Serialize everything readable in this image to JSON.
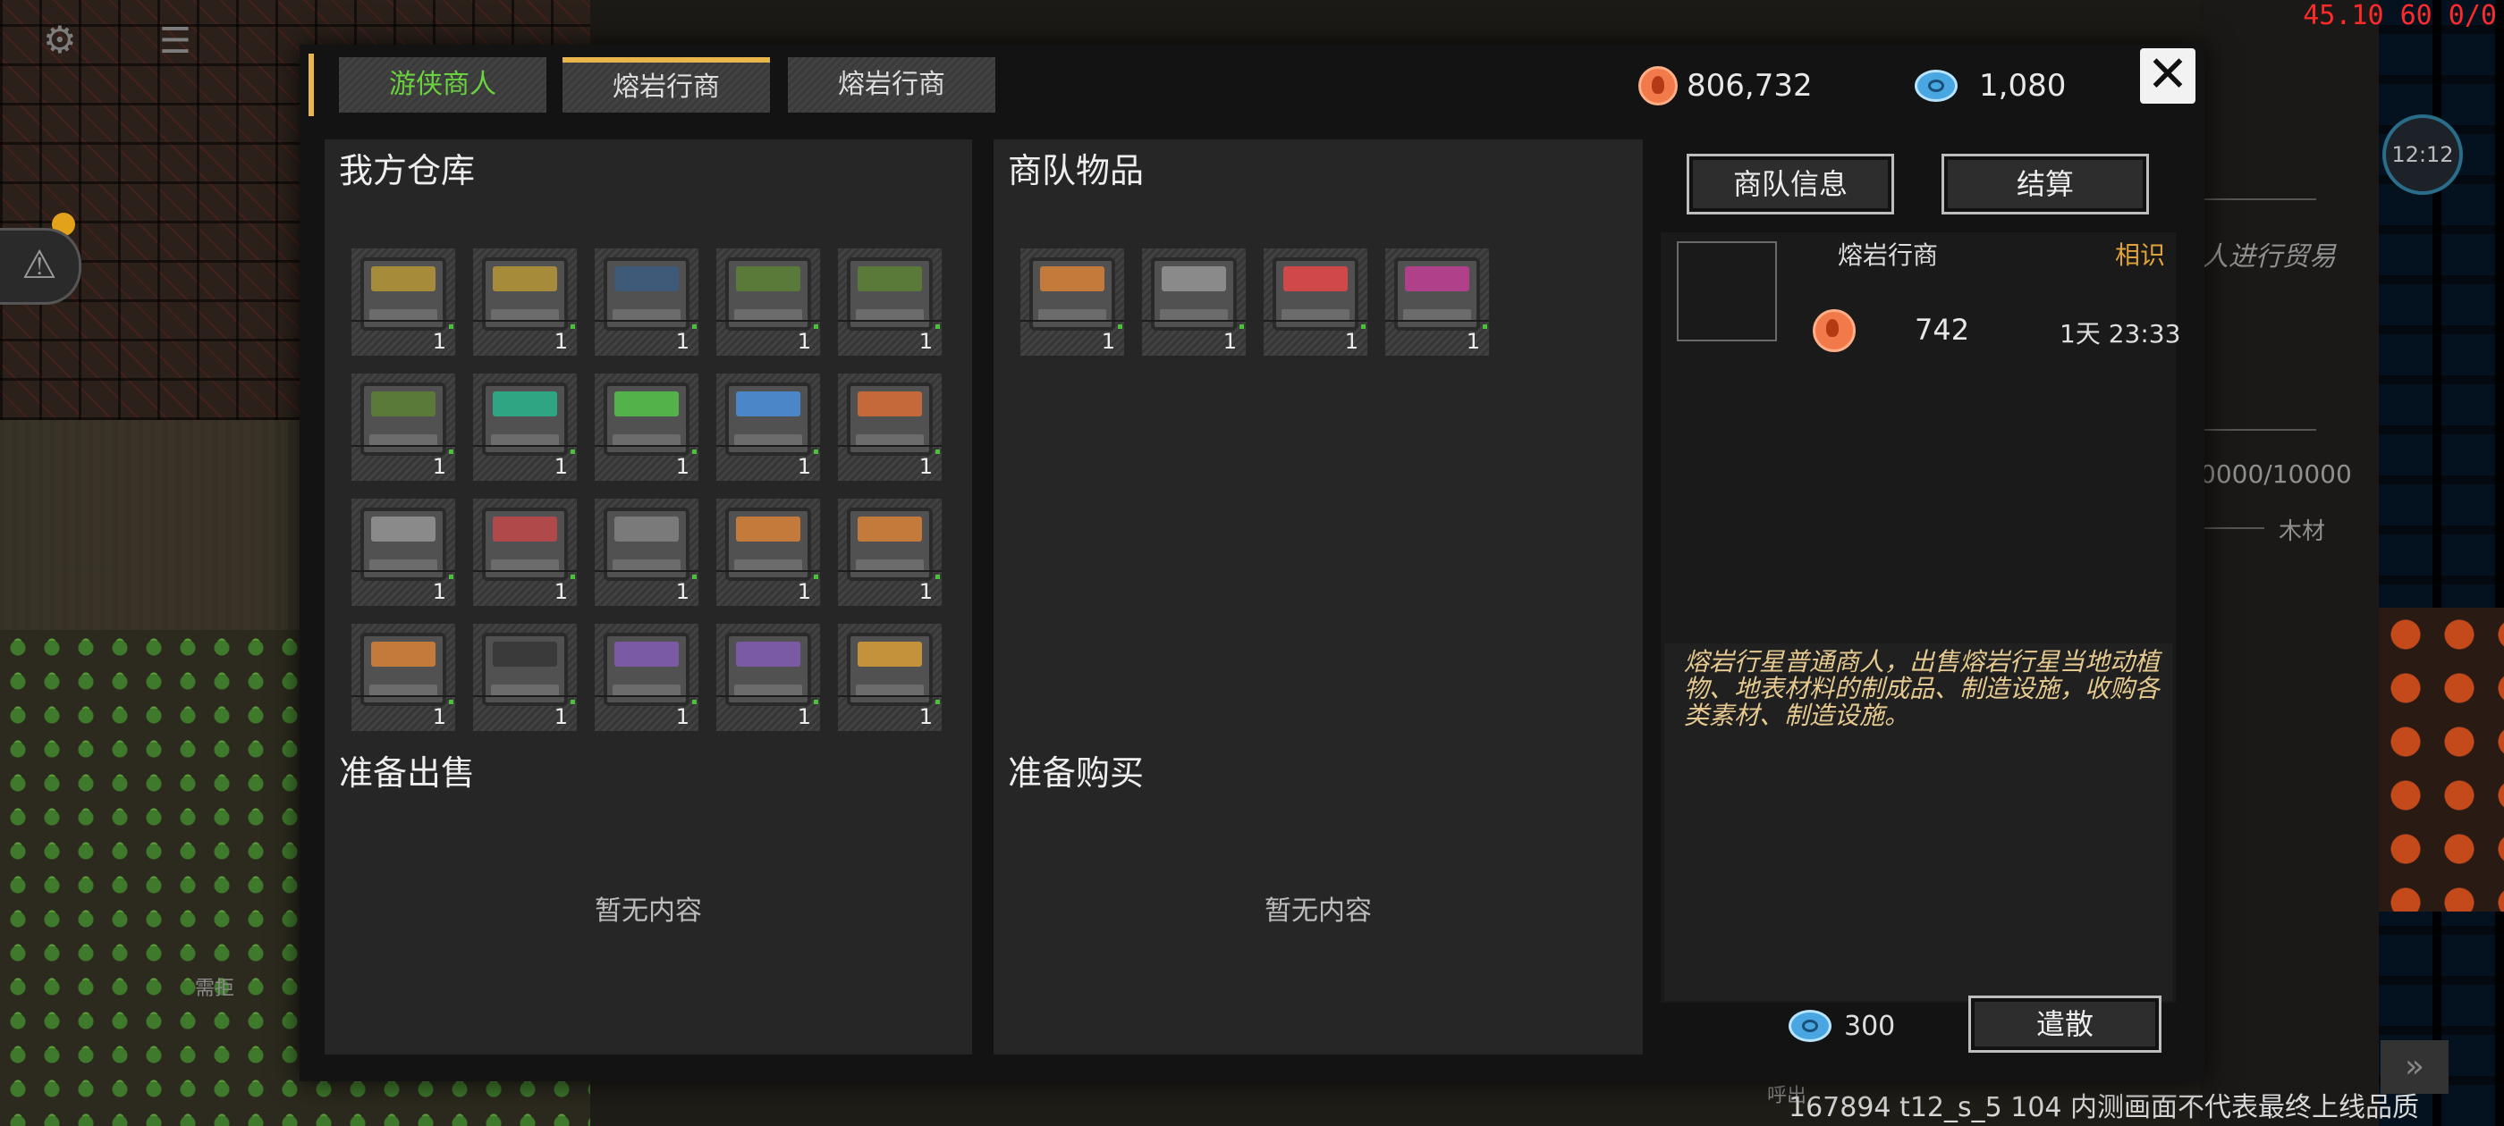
{
  "overlay": {
    "fps": "45.10 60 0/0",
    "build_info": "167894 t12_s_5 104 内测画面不代表最终上线品质",
    "map_label": "需拒",
    "map_label_2": "呼出",
    "side_text_trade": "人进行贸易",
    "side_text_capacity": "0000/10000",
    "side_text_wood": "木材",
    "clock": "12:12"
  },
  "hud": {
    "gear": "⚙",
    "chat": "☰",
    "alert": "⚠",
    "fast_forward": "»"
  },
  "tabs": [
    {
      "label": "游侠商人"
    },
    {
      "label": "熔岩行商"
    },
    {
      "label": "熔岩行商"
    }
  ],
  "currency": {
    "coins": "806,732",
    "gems": "1,080"
  },
  "close_label": "✕",
  "my_storage": {
    "title": "我方仓库",
    "items": [
      {
        "qty": "1",
        "color": "#a58b3a"
      },
      {
        "qty": "1",
        "color": "#a58b3a"
      },
      {
        "qty": "1",
        "color": "#3e5a78"
      },
      {
        "qty": "1",
        "color": "#5a7a3a"
      },
      {
        "qty": "1",
        "color": "#5a7a3a"
      },
      {
        "qty": "1",
        "color": "#5a7a3a"
      },
      {
        "qty": "1",
        "color": "#2fa584"
      },
      {
        "qty": "1",
        "color": "#53b34a"
      },
      {
        "qty": "1",
        "color": "#4a86c8"
      },
      {
        "qty": "1",
        "color": "#c46a3a"
      },
      {
        "qty": "1",
        "color": "#8a8a8a"
      },
      {
        "qty": "1",
        "color": "#b04a4a"
      },
      {
        "qty": "1",
        "color": "#7a7a7a"
      },
      {
        "qty": "1",
        "color": "#c47a3a"
      },
      {
        "qty": "1",
        "color": "#c47a3a"
      },
      {
        "qty": "1",
        "color": "#c47a3a"
      },
      {
        "qty": "1",
        "color": "#3a3a3a"
      },
      {
        "qty": "1",
        "color": "#7a5aa3"
      },
      {
        "qty": "1",
        "color": "#7a5aa3"
      },
      {
        "qty": "1",
        "color": "#c4923a"
      }
    ]
  },
  "caravan_goods": {
    "title": "商队物品",
    "items": [
      {
        "qty": "1",
        "color": "#c47a3a"
      },
      {
        "qty": "1",
        "color": "#8a8a8a"
      },
      {
        "qty": "1",
        "color": "#d04848"
      },
      {
        "qty": "1",
        "color": "#b0408a"
      }
    ]
  },
  "sell_panel": {
    "title": "准备出售",
    "empty": "暂无内容"
  },
  "buy_panel": {
    "title": "准备购买",
    "empty": "暂无内容"
  },
  "actions": {
    "info_label": "商队信息",
    "settle_label": "结算"
  },
  "caravan_info": {
    "name": "熔岩行商",
    "relation": "相识",
    "coins": "742",
    "time_left": "1天 23:33",
    "description": "熔岩行星普通商人，出售熔岩行星当地动植物、地表材料的制成品、制造设施，收购各类素材、制造设施。"
  },
  "dismiss": {
    "cost": "300",
    "label": "遣散"
  },
  "colors": {
    "accent": "#e8b64a",
    "first_tab_text": "#69d23e",
    "coin": "#f27a4a",
    "gem": "#4aa6e0",
    "relation": "#e0a23b",
    "description": "#e5c98f"
  }
}
